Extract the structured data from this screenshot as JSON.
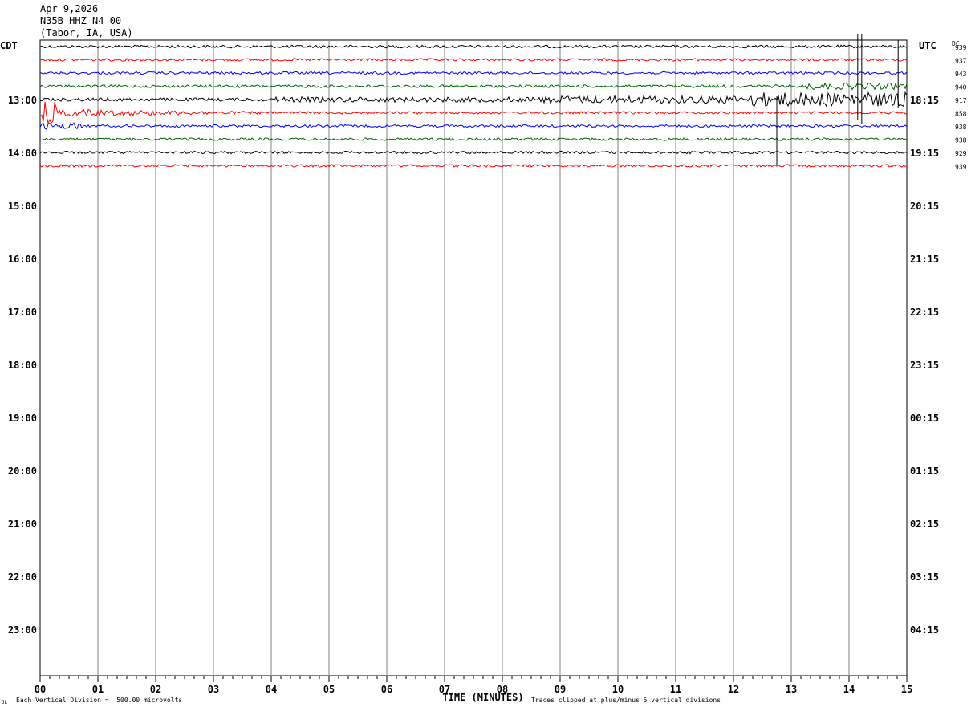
{
  "header": {
    "date": "Apr 9,2026",
    "channel": "N35B HHZ N4 00",
    "location": "(Tabor, IA, USA)"
  },
  "left_zone_label": "CDT",
  "right_zone_label": "UTC",
  "dc_label": "DC",
  "dc_values": [
    "939",
    "937",
    "943",
    "940",
    "917",
    "858",
    "938",
    "938",
    "929",
    "939"
  ],
  "footer": {
    "scale_note": "Each Vertical Division =  500.00 microvolts",
    "clip_note": "Traces clipped at plus/minus 5 vertical divisions",
    "corner_mark": "JL"
  },
  "chart_data": {
    "type": "line",
    "title": "",
    "xlabel": "TIME (MINUTES)",
    "ylabel": "",
    "x_ticks": [
      "00",
      "01",
      "02",
      "03",
      "04",
      "05",
      "06",
      "07",
      "08",
      "09",
      "10",
      "11",
      "12",
      "13",
      "14",
      "15"
    ],
    "xlim": [
      0,
      15
    ],
    "grid": true,
    "left_hour_labels": [
      "13:00",
      "14:00",
      "15:00",
      "16:00",
      "17:00",
      "18:00",
      "19:00",
      "20:00",
      "21:00",
      "22:00",
      "23:00"
    ],
    "right_hour_labels": [
      "18:15",
      "19:15",
      "20:15",
      "21:15",
      "22:15",
      "23:15",
      "00:15",
      "01:15",
      "02:15",
      "03:15",
      "04:15"
    ],
    "series": [
      {
        "color": "#000000"
      },
      {
        "color": "#ff0000"
      },
      {
        "color": "#0000ff"
      },
      {
        "color": "#006400"
      },
      {
        "color": "#000000"
      },
      {
        "color": "#ff0000"
      },
      {
        "color": "#0000ff"
      },
      {
        "color": "#006400"
      },
      {
        "color": "#000000"
      },
      {
        "color": "#ff0000"
      }
    ]
  }
}
